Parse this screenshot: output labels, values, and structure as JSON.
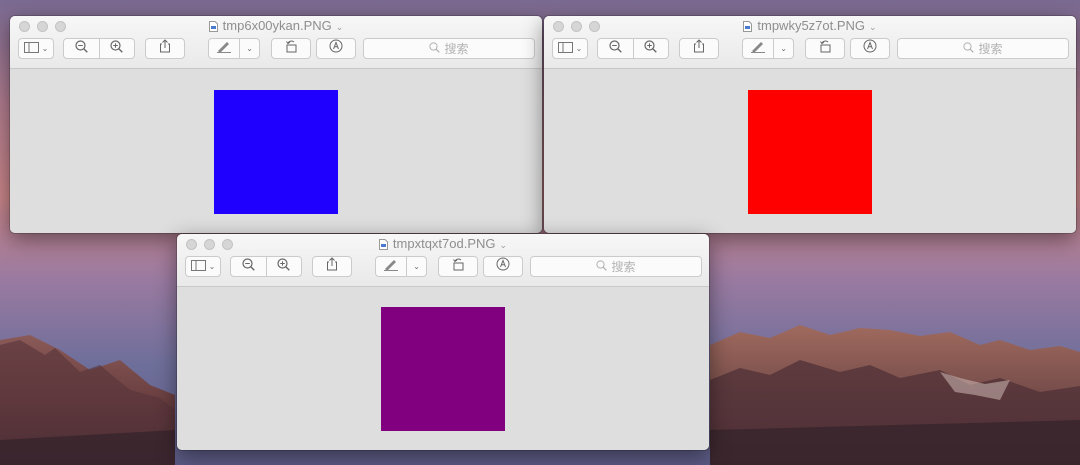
{
  "windows": [
    {
      "title": "tmp6x00ykan.PNG",
      "search_placeholder": "搜索",
      "image_color": "#1f00ff"
    },
    {
      "title": "tmpwky5z7ot.PNG",
      "search_placeholder": "搜索",
      "image_color": "#ff0000"
    },
    {
      "title": "tmpxtqxt7od.PNG",
      "search_placeholder": "搜索",
      "image_color": "#800080"
    }
  ],
  "icons": {
    "sidebar": "sidebar-icon",
    "zoom_out": "zoom-out-icon",
    "zoom_in": "zoom-in-icon",
    "share": "share-icon",
    "markup": "markup-icon",
    "rotate": "rotate-icon",
    "annotate": "annotate-icon",
    "search": "search-icon"
  }
}
